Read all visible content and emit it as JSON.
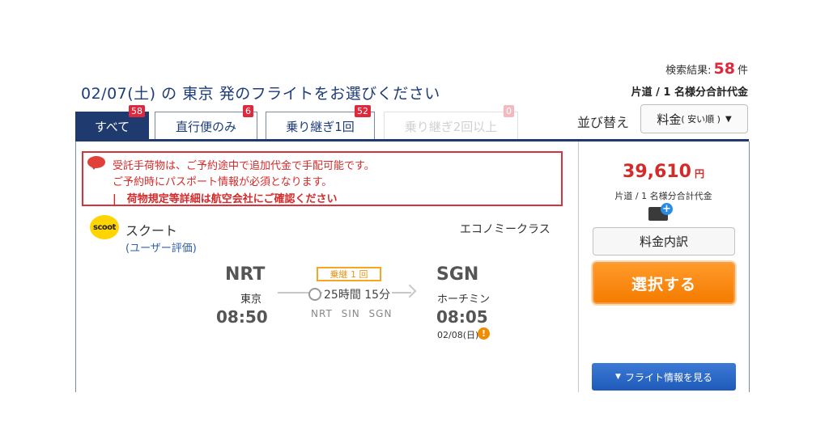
{
  "header": {
    "title": "02/07(土) の 東京 発のフライトをお選びください",
    "result_label": "検索結果:",
    "result_count": "58",
    "result_unit": "件",
    "price_basis": "片道 / 1 名様分合計代金",
    "sort_label": "並び替え",
    "sort_selected": "料金",
    "sort_selected_sub": "( 安い順 )"
  },
  "tabs": [
    {
      "label": "すべて",
      "count": "58"
    },
    {
      "label": "直行便のみ",
      "count": "6"
    },
    {
      "label": "乗り継ぎ1回",
      "count": "52"
    },
    {
      "label": "乗り継ぎ2回以上",
      "count": "0"
    }
  ],
  "notice": {
    "line1": "受託手荷物は、ご予約途中で追加代金で手配可能です。",
    "line2": "ご予約時にパスポート情報が必須となります。",
    "line3": "|　荷物規定等詳細は航空会社にご確認ください"
  },
  "flight": {
    "airline_logo_text": "scoot",
    "airline_name": "スクート",
    "user_rating": "(ユーザー評価)",
    "cabin_class": "エコノミークラス",
    "departure": {
      "code": "NRT",
      "city": "東京",
      "time": "08:50"
    },
    "stops_label": "乗継 1 回",
    "duration": "25時間 15分",
    "via": "NRT SIN SGN",
    "arrival": {
      "code": "SGN",
      "city": "ホーチミン",
      "time": "08:05",
      "date": "02/08(日)"
    }
  },
  "price_panel": {
    "price": "39,610",
    "currency": "円",
    "note": "片道 / 1 名様分合計代金",
    "breakdown_label": "料金内訳",
    "select_label": "選択する",
    "flight_info_label": "フライト情報を見る"
  },
  "colors": {
    "navy": "#1e3a6e",
    "price_red": "#d42a2a",
    "select_orange": "#f57c00",
    "info_blue": "#1f5ab8"
  }
}
